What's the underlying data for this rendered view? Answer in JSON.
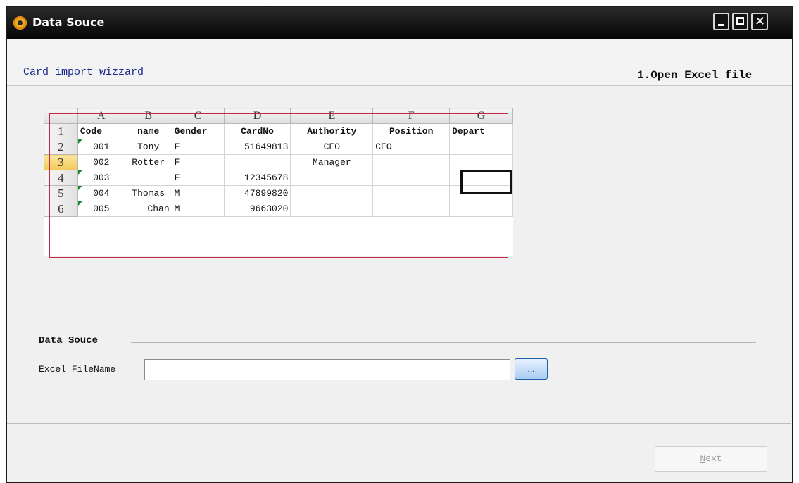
{
  "window": {
    "title": "Data Souce"
  },
  "header": {
    "wizard_title": "Card import wizzard",
    "step_title": "1.Open Excel file"
  },
  "spreadsheet": {
    "column_letters": [
      "A",
      "B",
      "C",
      "D",
      "E",
      "F",
      "G"
    ],
    "row_numbers": [
      "1",
      "2",
      "3",
      "4",
      "5",
      "6"
    ],
    "selected_column": "G",
    "selected_row": "3",
    "rows": [
      [
        "Code",
        "name",
        "Gender",
        "CardNo",
        "Authority",
        "Position",
        "Depart"
      ],
      [
        "001",
        "Tony",
        "F",
        "51649813",
        "CEO",
        "CEO",
        ""
      ],
      [
        "002",
        "Rotter",
        "F",
        "",
        "Manager",
        "",
        ""
      ],
      [
        "003",
        "",
        "F",
        "12345678",
        "",
        "",
        ""
      ],
      [
        "004",
        "Thomas",
        "M",
        "47899820",
        "",
        "",
        ""
      ],
      [
        "005",
        "Chan",
        "M",
        "9663020",
        "",
        "",
        ""
      ]
    ]
  },
  "data_source": {
    "section_label": "Data Souce",
    "filename_label": "Excel FileName",
    "filename_value": "",
    "browse_label": "..."
  },
  "footer": {
    "next_underlined": "N",
    "next_rest": "ext"
  }
}
